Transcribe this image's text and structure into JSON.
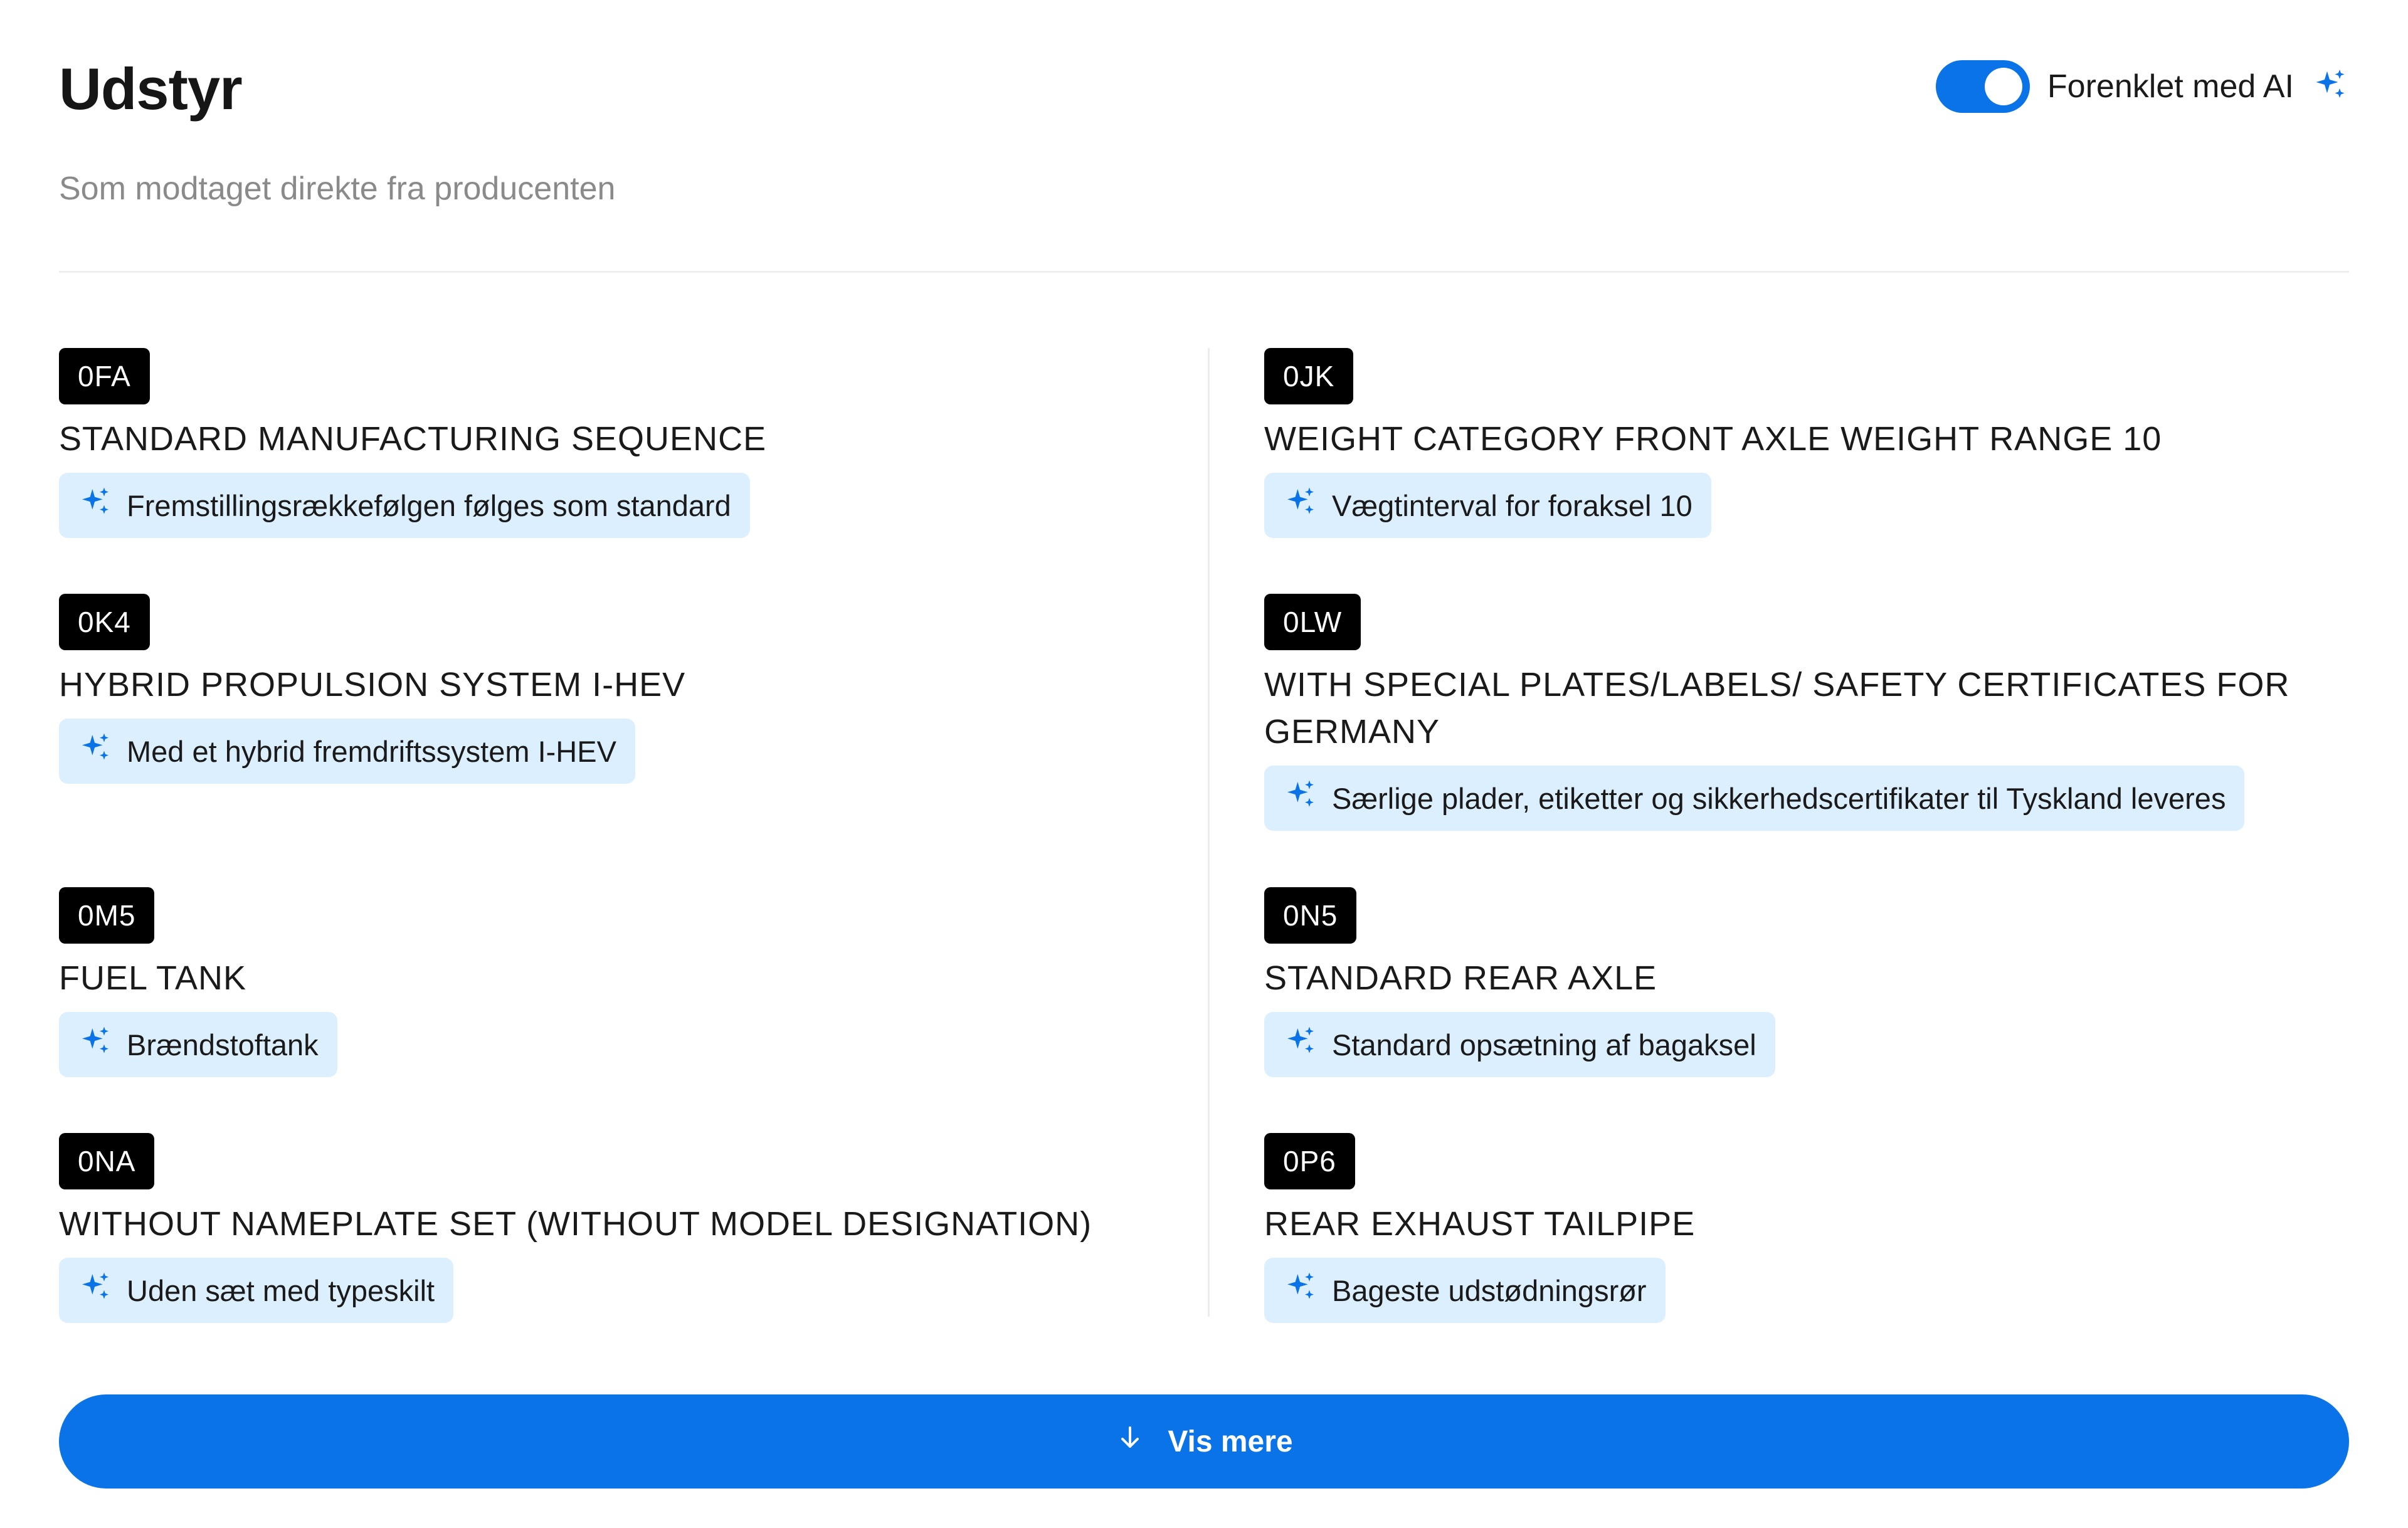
{
  "header": {
    "title": "Udstyr",
    "subtitle": "Som modtaget direkte fra producenten",
    "ai_toggle": {
      "label": "Forenklet med AI",
      "on": true
    }
  },
  "colors": {
    "accent": "#0a73e8",
    "chip_bg": "#dcefff",
    "code_bg": "#000000"
  },
  "equipment": {
    "left": [
      {
        "code": "0FA",
        "name": "STANDARD MANUFACTURING SEQUENCE",
        "ai_text": "Fremstillingsrækkefølgen følges som standard"
      },
      {
        "code": "0K4",
        "name": "HYBRID PROPULSION SYSTEM I-HEV",
        "ai_text": "Med et hybrid fremdriftssystem I-HEV"
      },
      {
        "code": "0M5",
        "name": "FUEL TANK",
        "ai_text": "Brændstoftank"
      },
      {
        "code": "0NA",
        "name": "WITHOUT NAMEPLATE SET (WITHOUT MODEL DESIGNATION)",
        "ai_text": "Uden sæt med typeskilt"
      }
    ],
    "right": [
      {
        "code": "0JK",
        "name": "WEIGHT CATEGORY FRONT AXLE WEIGHT RANGE 10",
        "ai_text": "Vægtinterval for foraksel 10"
      },
      {
        "code": "0LW",
        "name": "WITH SPECIAL PLATES/LABELS/ SAFETY CERTIFICATES FOR GERMANY",
        "ai_text": "Særlige plader, etiketter og sikkerhedscertifikater til Tyskland leveres"
      },
      {
        "code": "0N5",
        "name": "STANDARD REAR AXLE",
        "ai_text": "Standard opsætning af bagaksel"
      },
      {
        "code": "0P6",
        "name": "REAR EXHAUST TAILPIPE",
        "ai_text": "Bageste udstødningsrør"
      }
    ]
  },
  "show_more": {
    "label": "Vis mere",
    "icon": "arrow-down-icon"
  }
}
